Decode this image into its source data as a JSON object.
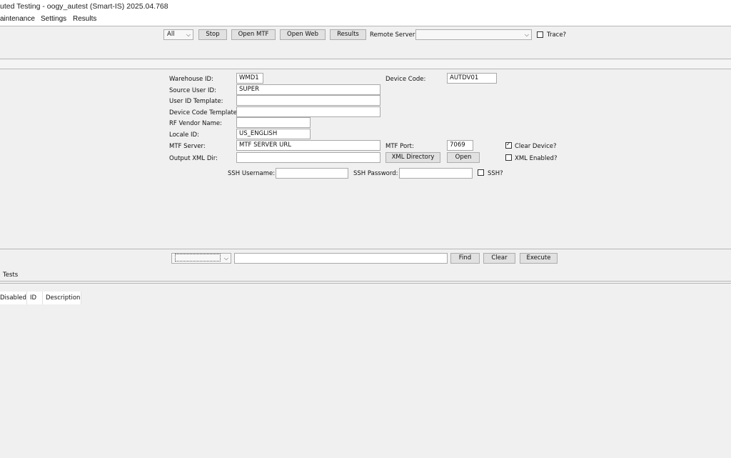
{
  "window": {
    "title": "uted Testing - oogy_autest (Smart-IS) 2025.04.768"
  },
  "menu": {
    "items": [
      "aintenance",
      "Settings",
      "Results"
    ]
  },
  "toolbar": {
    "scope_value": "All",
    "stop_label": "Stop",
    "open_mtf_label": "Open MTF",
    "open_web_label": "Open Web",
    "results_label": "Results",
    "remote_server_label": "Remote Server:",
    "remote_server_value": "",
    "trace_label": "Trace?",
    "trace_checked": false
  },
  "form": {
    "warehouse_id_label": "Warehouse ID:",
    "warehouse_id_value": "WMD1",
    "source_user_id_label": "Source User ID:",
    "source_user_id_value": "SUPER",
    "user_id_template_label": "User ID Template:",
    "user_id_template_value": "",
    "device_code_template_label": "Device Code Template:",
    "device_code_template_value": "",
    "rf_vendor_name_label": "RF Vendor Name:",
    "rf_vendor_name_value": "",
    "locale_id_label": "Locale ID:",
    "locale_id_value": "US_ENGLISH",
    "mtf_server_label": "MTF Server:",
    "mtf_server_value": "MTF SERVER URL",
    "output_xml_dir_label": "Output XML Dir:",
    "output_xml_dir_value": "",
    "device_code_label": "Device Code:",
    "device_code_value": "AUTDV01",
    "mtf_port_label": "MTF Port:",
    "mtf_port_value": "7069",
    "clear_device_label": "Clear Device?",
    "clear_device_checked": true,
    "xml_enabled_label": "XML Enabled?",
    "xml_enabled_checked": false,
    "xml_directory_label": "XML Directory",
    "open_label": "Open",
    "ssh_username_label": "SSH Username:",
    "ssh_username_value": "",
    "ssh_password_label": "SSH Password:",
    "ssh_password_value": "",
    "ssh_label": "SSH?",
    "ssh_checked": false
  },
  "search": {
    "filter_value": "",
    "query_value": "",
    "find_label": "Find",
    "clear_label": "Clear",
    "execute_label": "Execute"
  },
  "tabs": {
    "tests_label": "Tests"
  },
  "table": {
    "columns": [
      "Disabled",
      "ID",
      "Description"
    ]
  }
}
